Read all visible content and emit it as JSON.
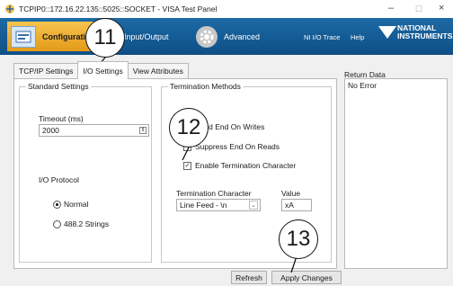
{
  "window": {
    "title": "TCPIP0::172.16.22.135::5025::SOCKET - VISA Test Panel",
    "min": "–",
    "max": "☐",
    "close": "×"
  },
  "toolbar": {
    "configuration": "Configuration",
    "input_output": "Input/Output",
    "advanced": "Advanced",
    "ni_io_trace": "NI I/O Trace",
    "help": "Help",
    "logo_line1": "NATIONAL",
    "logo_line2": "INSTRUMENTS"
  },
  "tabs": [
    "TCP/IP Settings",
    "I/O Settings",
    "View Attributes"
  ],
  "standard_settings": {
    "legend": "Standard Settings",
    "timeout_label": "Timeout (ms)",
    "timeout_value": "2000",
    "io_protocol_label": "I/O Protocol",
    "protocol_normal": "Normal",
    "protocol_488": "488.2 Strings"
  },
  "termination": {
    "legend": "Termination Methods",
    "send_end": "Send End On Writes",
    "suppress_end": "Suppress End On Reads",
    "enable_term": "Enable Termination Character",
    "term_char_label": "Termination Character",
    "term_char_value": "Line Feed - \\n",
    "value_label": "Value",
    "value_value": "xA"
  },
  "return_data": {
    "label": "Return Data",
    "value": "No Error"
  },
  "buttons": {
    "refresh": "Refresh",
    "apply": "Apply Changes"
  },
  "callouts": [
    "11",
    "12",
    "13"
  ],
  "colors": {
    "toolbar_blue": "#1d6aa5",
    "config_orange": "#f0b02d"
  }
}
